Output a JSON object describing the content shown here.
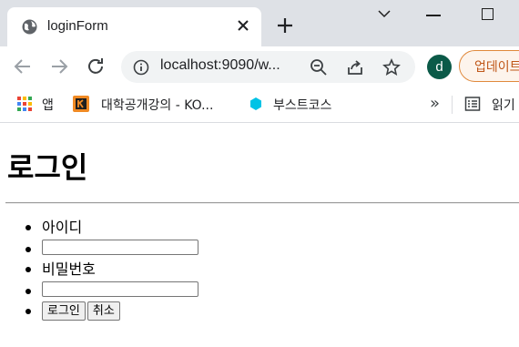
{
  "browser": {
    "tab": {
      "title": "loginForm"
    },
    "address": {
      "url": "localhost:9090/w..."
    },
    "profile": {
      "initial": "d"
    },
    "update_button": {
      "label": "업데이트"
    },
    "bookmarks": [
      {
        "label": "앱",
        "icon": "apps-grid-icon"
      },
      {
        "label": "대학공개강의 - KO...",
        "icon": "kocw-icon"
      },
      {
        "label": "부스트코스",
        "icon": "boostcourse-icon"
      }
    ],
    "bookmarks_more": "»",
    "reading_list": {
      "label": "읽기"
    }
  },
  "page": {
    "heading": "로그인",
    "id_label": "아이디",
    "id_value": "",
    "password_label": "비밀번호",
    "password_value": "",
    "login_button": "로그인",
    "cancel_button": "취소"
  },
  "colors": {
    "tabstrip_bg": "#dee1e6",
    "avatar_bg": "#0b5a48",
    "update_border": "#e0893c"
  }
}
